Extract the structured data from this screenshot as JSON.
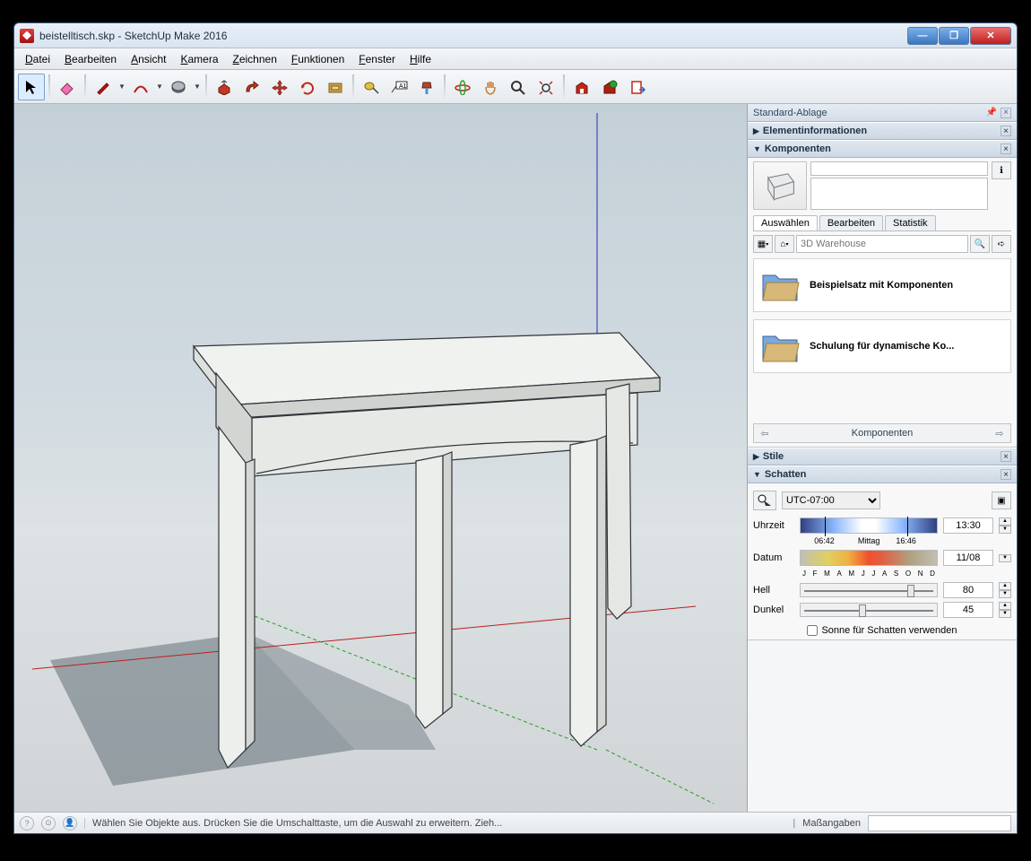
{
  "window": {
    "title": "beistelltisch.skp - SketchUp Make 2016"
  },
  "menu": [
    "Datei",
    "Bearbeiten",
    "Ansicht",
    "Kamera",
    "Zeichnen",
    "Funktionen",
    "Fenster",
    "Hilfe"
  ],
  "toolbar_icons": [
    "select",
    "eraser",
    "pencil",
    "arc",
    "circle",
    "push-pull",
    "follow-me",
    "move",
    "rotate",
    "offset",
    "tape-measure",
    "text",
    "paint-bucket",
    "orbit",
    "pan",
    "zoom",
    "zoom-extents",
    "warehouse",
    "extensions",
    "layout-export"
  ],
  "tray": {
    "title": "Standard-Ablage",
    "panels": {
      "entity_info": "Elementinformationen",
      "components": {
        "title": "Komponenten",
        "tabs": [
          "Auswählen",
          "Bearbeiten",
          "Statistik"
        ],
        "search_placeholder": "3D Warehouse",
        "items": [
          "Beispielsatz mit Komponenten",
          "Schulung für dynamische Ko..."
        ],
        "nav_label": "Komponenten"
      },
      "styles": "Stile",
      "shadows": {
        "title": "Schatten",
        "timezone": "UTC-07:00",
        "time_label": "Uhrzeit",
        "time_marks": {
          "start": "06:42",
          "mid": "Mittag",
          "end": "16:46"
        },
        "time_value": "13:30",
        "date_label": "Datum",
        "date_months": "J F M A M J J A S O N D",
        "date_value": "11/08",
        "light_label": "Hell",
        "light_value": "80",
        "dark_label": "Dunkel",
        "dark_value": "45",
        "sun_checkbox": "Sonne für Schatten verwenden"
      }
    }
  },
  "status": {
    "hint": "Wählen Sie Objekte aus. Drücken Sie die Umschalttaste, um die Auswahl zu erweitern. Zieh...",
    "measure_label": "Maßangaben"
  }
}
